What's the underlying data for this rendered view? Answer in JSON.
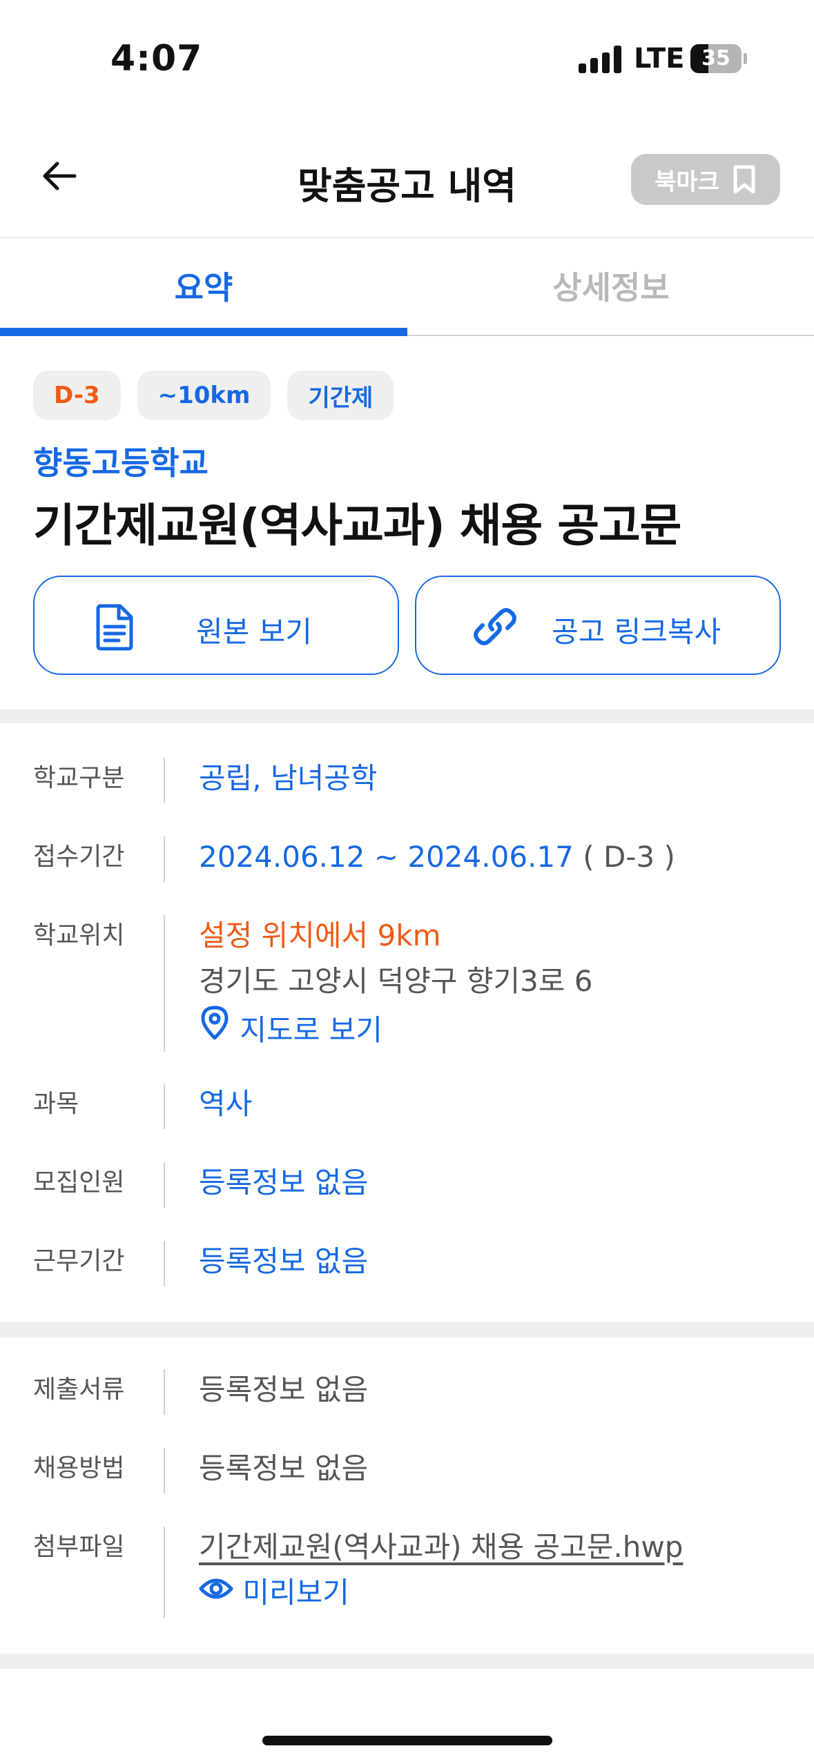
{
  "status_bar": {
    "time": "4:07",
    "network": "LTE",
    "battery": "35",
    "battery_level_pct": 35
  },
  "header": {
    "title": "맞춤공고 내역",
    "bookmark_label": "북마크"
  },
  "tabs": [
    {
      "label": "요약",
      "active": true
    },
    {
      "label": "상세정보",
      "active": false
    }
  ],
  "summary": {
    "chips": [
      "D-3",
      "~10km",
      "기간제"
    ],
    "school": "향동고등학교",
    "title": "기간제교원(역사교과) 채용 공고문",
    "view_original_label": "원본 보기",
    "copy_link_label": "공고 링크복사"
  },
  "info": {
    "school_type": {
      "label": "학교구분",
      "value": "공립, 남녀공학"
    },
    "period": {
      "label": "접수기간",
      "value": "2024.06.12 ~ 2024.06.17",
      "dday": "( D-3 )"
    },
    "location": {
      "label": "학교위치",
      "distance": "설정 위치에서 9km",
      "address": "경기도 고양시 덕양구 향기3로 6",
      "map_label": "지도로 보기"
    },
    "subject": {
      "label": "과목",
      "value": "역사"
    },
    "recruits": {
      "label": "모집인원",
      "value": "등록정보 없음"
    },
    "work_period": {
      "label": "근무기간",
      "value": "등록정보 없음"
    }
  },
  "extra": {
    "documents": {
      "label": "제출서류",
      "value": "등록정보 없음"
    },
    "method": {
      "label": "채용방법",
      "value": "등록정보 없음"
    },
    "attachment": {
      "label": "첨부파일",
      "filename": "기간제교원(역사교과) 채용 공고문.hwp",
      "preview_label": "미리보기"
    }
  },
  "colors": {
    "primary": "#1668e3",
    "accent_orange": "#f05a15",
    "muted": "#555555",
    "divider": "#efefef"
  },
  "icons": [
    "arrow-left-icon",
    "bookmark-icon",
    "document-icon",
    "link-icon",
    "location-pin-icon",
    "eye-icon"
  ]
}
